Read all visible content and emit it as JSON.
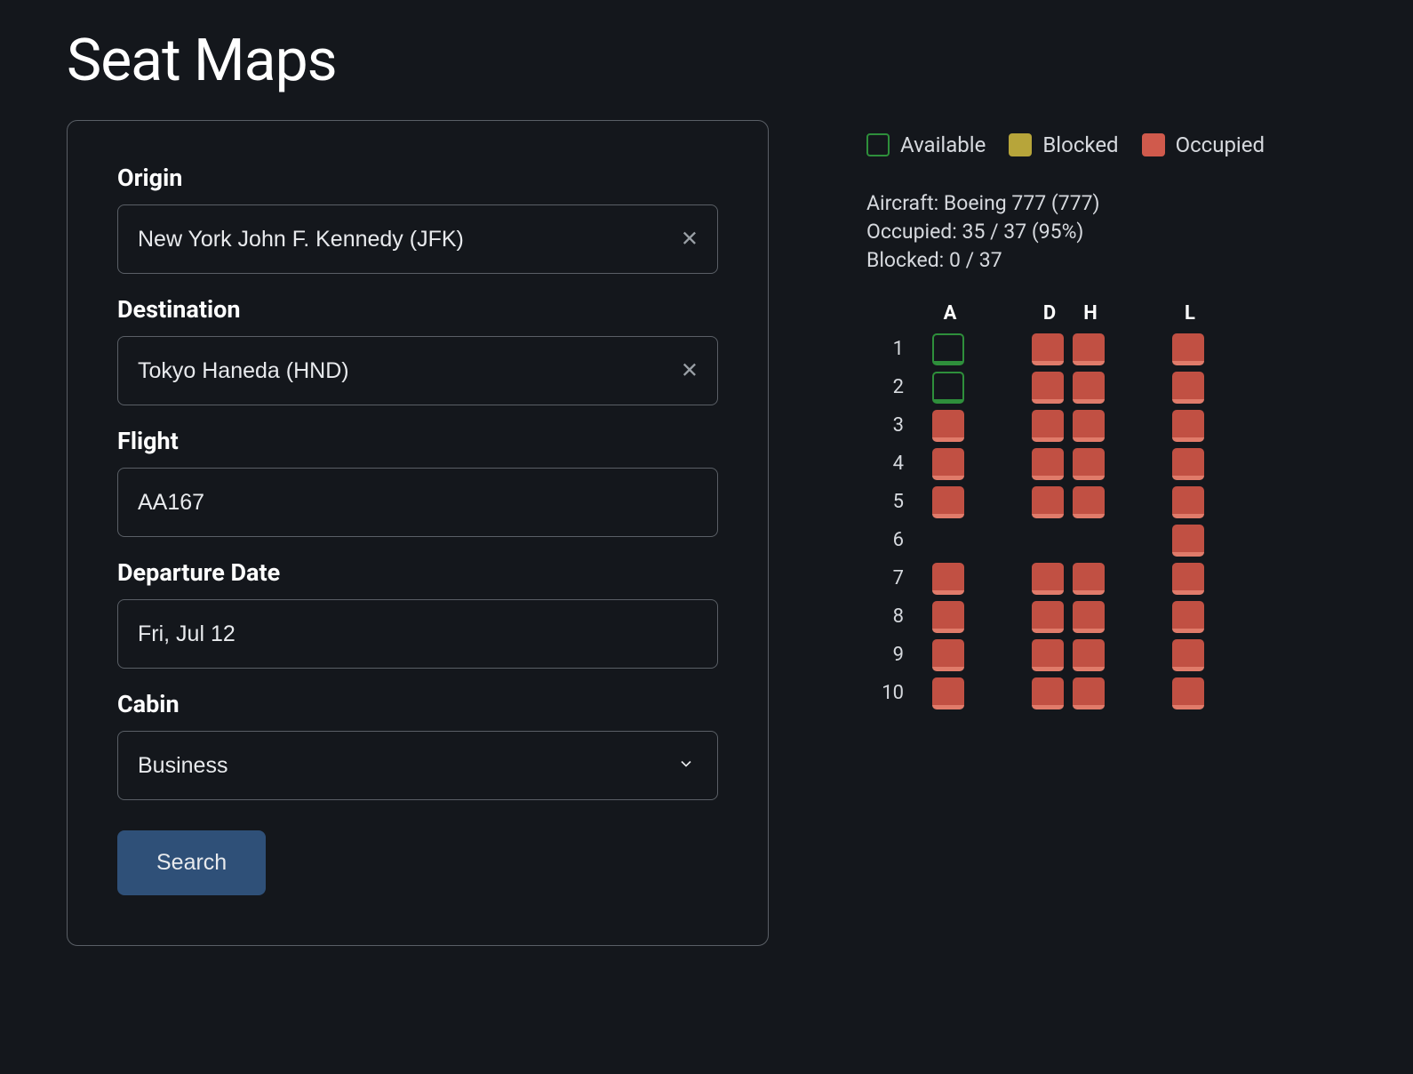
{
  "page": {
    "title": "Seat Maps"
  },
  "form": {
    "origin": {
      "label": "Origin",
      "value": "New York John F. Kennedy (JFK)"
    },
    "destination": {
      "label": "Destination",
      "value": "Tokyo Haneda (HND)"
    },
    "flight": {
      "label": "Flight",
      "value": "AA167"
    },
    "date": {
      "label": "Departure Date",
      "value": "Fri, Jul 12"
    },
    "cabin": {
      "label": "Cabin",
      "value": "Business"
    },
    "search": "Search"
  },
  "legend": {
    "available": "Available",
    "blocked": "Blocked",
    "occupied": "Occupied"
  },
  "info": {
    "aircraft_line": "Aircraft: Boeing 777 (777)",
    "occupied_line": "Occupied: 35 / 37 (95%)",
    "blocked_line": "Blocked: 0 / 37"
  },
  "seatmap": {
    "columns": [
      "A",
      "",
      "D",
      "H",
      "",
      "L"
    ],
    "rows": [
      {
        "num": "1",
        "seats": [
          "available",
          null,
          "occupied",
          "occupied",
          null,
          "occupied"
        ]
      },
      {
        "num": "2",
        "seats": [
          "available",
          null,
          "occupied",
          "occupied",
          null,
          "occupied"
        ]
      },
      {
        "num": "3",
        "seats": [
          "occupied",
          null,
          "occupied",
          "occupied",
          null,
          "occupied"
        ]
      },
      {
        "num": "4",
        "seats": [
          "occupied",
          null,
          "occupied",
          "occupied",
          null,
          "occupied"
        ]
      },
      {
        "num": "5",
        "seats": [
          "occupied",
          null,
          "occupied",
          "occupied",
          null,
          "occupied"
        ]
      },
      {
        "num": "6",
        "seats": [
          "empty",
          null,
          "empty",
          "empty",
          null,
          "occupied"
        ]
      },
      {
        "num": "7",
        "seats": [
          "occupied",
          null,
          "occupied",
          "occupied",
          null,
          "occupied"
        ]
      },
      {
        "num": "8",
        "seats": [
          "occupied",
          null,
          "occupied",
          "occupied",
          null,
          "occupied"
        ]
      },
      {
        "num": "9",
        "seats": [
          "occupied",
          null,
          "occupied",
          "occupied",
          null,
          "occupied"
        ]
      },
      {
        "num": "10",
        "seats": [
          "occupied",
          null,
          "occupied",
          "occupied",
          null,
          "occupied"
        ]
      }
    ]
  }
}
